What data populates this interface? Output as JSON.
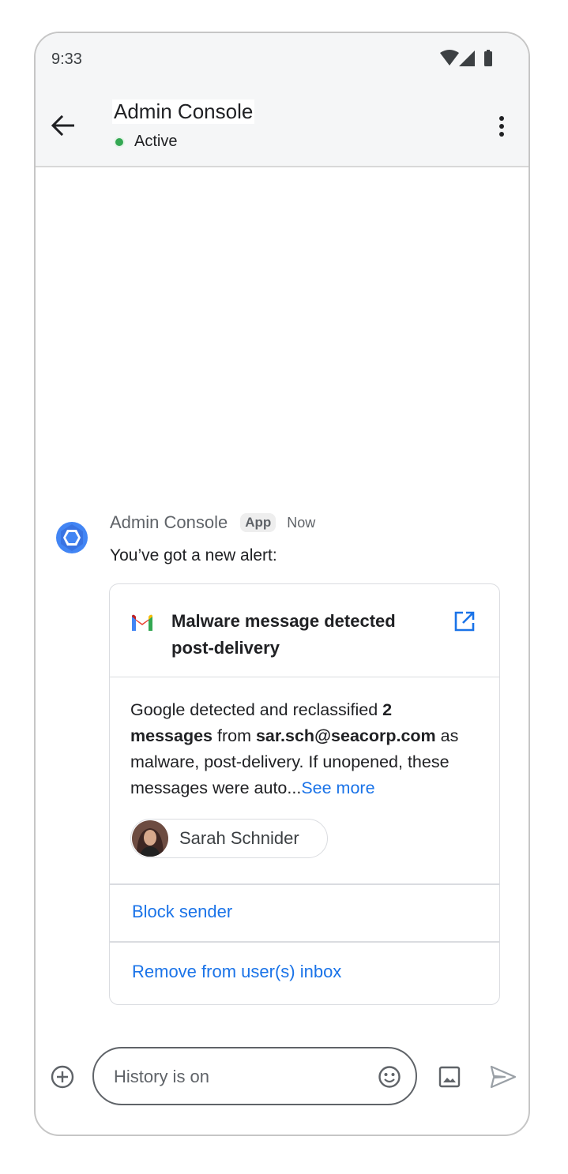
{
  "status_bar": {
    "time": "9:33"
  },
  "header": {
    "title": "Admin Console",
    "status": "Active",
    "status_color": "#34a853"
  },
  "message": {
    "sender": "Admin Console",
    "badge": "App",
    "time": "Now",
    "text": "You’ve got a new alert:"
  },
  "card": {
    "title": "Malware message detected post-delivery",
    "body_part1": "Google detected and reclassified ",
    "body_bold1": "2 messages",
    "body_part2": " from ",
    "body_bold2": "sar.sch@seacorp.com",
    "body_part3": " as malware, post-delivery. If unopened, these messages were auto...",
    "see_more": "See more",
    "user_chip": "Sarah Schnider",
    "action_block": "Block sender",
    "action_remove": "Remove from user(s) inbox"
  },
  "composer": {
    "placeholder": "History is on"
  },
  "colors": {
    "link": "#1a73e8",
    "header_bg": "#f5f6f7",
    "icon_blue": "#4285f4"
  },
  "icons": [
    "back-arrow-icon",
    "more-vert-icon",
    "wifi-icon",
    "signal-icon",
    "battery-icon",
    "admin-hexagon-icon",
    "gmail-icon",
    "open-in-new-icon",
    "add-circle-icon",
    "emoji-icon",
    "image-icon",
    "send-icon"
  ]
}
